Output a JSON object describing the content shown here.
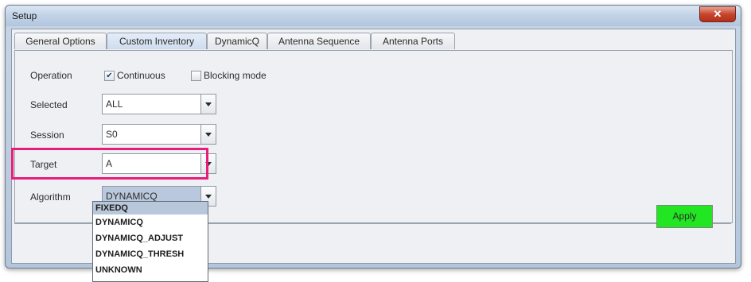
{
  "window": {
    "title": "Setup",
    "close_glyph": "✕"
  },
  "tabs": [
    {
      "label": "General Options",
      "active": false
    },
    {
      "label": "Custom Inventory",
      "active": true
    },
    {
      "label": "DynamicQ",
      "active": false
    },
    {
      "label": "Antenna Sequence",
      "active": false
    },
    {
      "label": "Antenna Ports",
      "active": false
    }
  ],
  "form": {
    "operation": {
      "label": "Operation",
      "continuous_label": "Continuous",
      "continuous_checked": true,
      "blocking_label": "Blocking mode",
      "blocking_checked": false
    },
    "selected": {
      "label": "Selected",
      "value": "ALL"
    },
    "session": {
      "label": "Session",
      "value": "S0"
    },
    "target": {
      "label": "Target",
      "value": "A"
    },
    "algorithm": {
      "label": "Algorithm",
      "value": "DYNAMICQ"
    }
  },
  "algorithm_options": [
    "FIXEDQ",
    "DYNAMICQ",
    "DYNAMICQ_ADJUST",
    "DYNAMICQ_THRESH",
    "UNKNOWN"
  ],
  "apply_label": "Apply",
  "colors": {
    "highlight": "#e81c79",
    "apply": "#22e622"
  }
}
